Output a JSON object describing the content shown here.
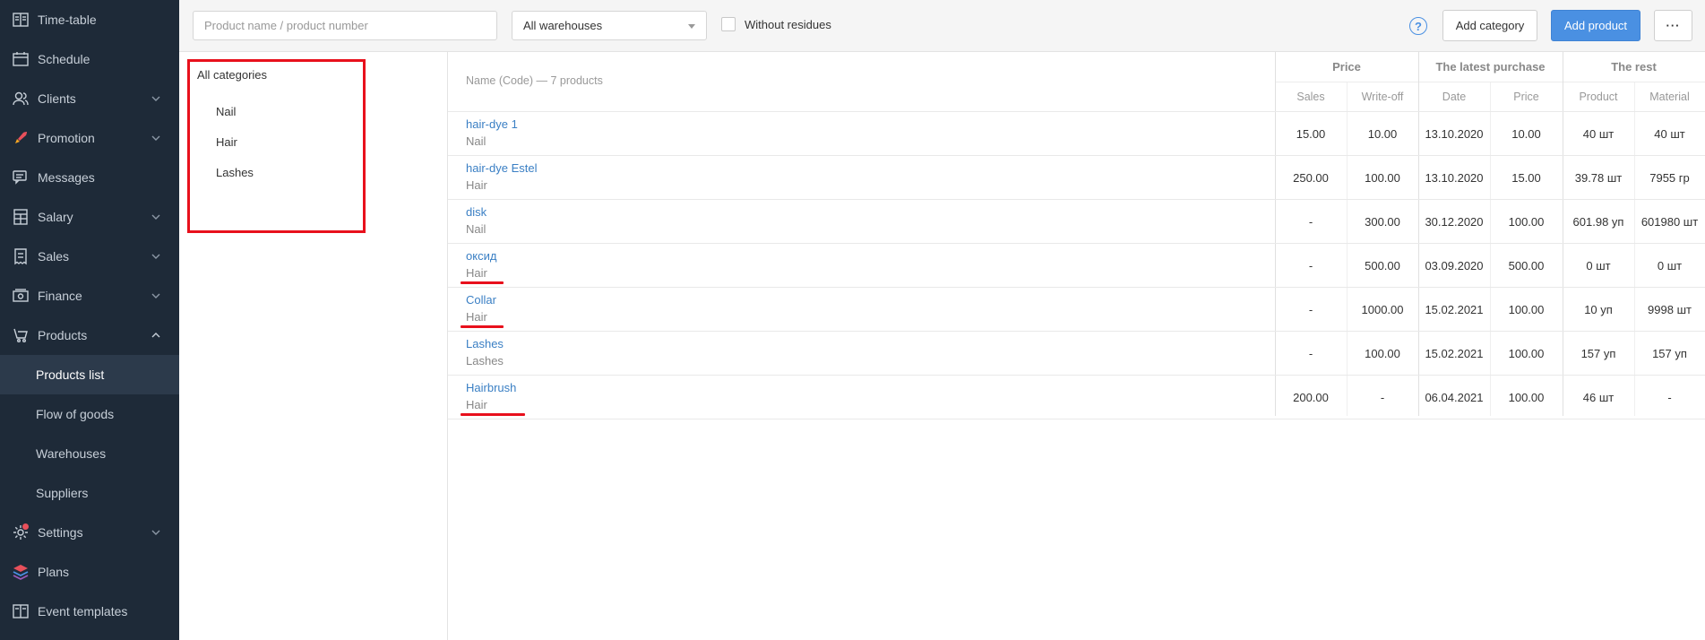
{
  "sidebar": {
    "items": [
      {
        "label": "Time-table",
        "icon": "book-icon",
        "chevron": false
      },
      {
        "label": "Schedule",
        "icon": "calendar-icon",
        "chevron": false
      },
      {
        "label": "Clients",
        "icon": "users-icon",
        "chevron": true
      },
      {
        "label": "Promotion",
        "icon": "rocket-icon",
        "chevron": true
      },
      {
        "label": "Messages",
        "icon": "chat-icon",
        "chevron": false
      },
      {
        "label": "Salary",
        "icon": "calculator-icon",
        "chevron": true
      },
      {
        "label": "Sales",
        "icon": "receipt-icon",
        "chevron": true
      },
      {
        "label": "Finance",
        "icon": "money-icon",
        "chevron": true
      },
      {
        "label": "Products",
        "icon": "cart-icon",
        "chevron": true,
        "expanded": true
      }
    ],
    "subitems": [
      {
        "label": "Products list",
        "active": true
      },
      {
        "label": "Flow of goods"
      },
      {
        "label": "Warehouses"
      },
      {
        "label": "Suppliers"
      }
    ],
    "bottom": [
      {
        "label": "Settings",
        "icon": "gear-icon",
        "chevron": true,
        "notification": true
      },
      {
        "label": "Plans",
        "icon": "layers-icon",
        "chevron": false
      },
      {
        "label": "Event templates",
        "icon": "book-icon",
        "chevron": false
      }
    ]
  },
  "toolbar": {
    "search_placeholder": "Product name / product number",
    "warehouse_value": "All warehouses",
    "without_residues_label": "Without residues",
    "help_label": "?",
    "add_category_label": "Add category",
    "add_product_label": "Add product",
    "more_label": "···"
  },
  "categories": {
    "all_label": "All categories",
    "items": [
      "Nail",
      "Hair",
      "Lashes"
    ]
  },
  "table": {
    "name_header": "Name (Code) — 7 products",
    "groups": {
      "price": "Price",
      "purchase": "The latest purchase",
      "rest": "The rest"
    },
    "sub": {
      "sales": "Sales",
      "writeoff": "Write-off",
      "date": "Date",
      "price": "Price",
      "product": "Product",
      "material": "Material"
    },
    "rows": [
      {
        "name": "hair-dye 1",
        "category": "Nail",
        "sales": "15.00",
        "writeoff": "10.00",
        "date": "13.10.2020",
        "price": "10.00",
        "product": "40 шт",
        "material": "40 шт",
        "underlined": false
      },
      {
        "name": "hair-dye Estel",
        "category": "Hair",
        "sales": "250.00",
        "writeoff": "100.00",
        "date": "13.10.2020",
        "price": "15.00",
        "product": "39.78 шт",
        "material": "7955 гр",
        "underlined": false
      },
      {
        "name": "disk",
        "category": "Nail",
        "sales": "-",
        "writeoff": "300.00",
        "date": "30.12.2020",
        "price": "100.00",
        "product": "601.98 уп",
        "material": "601980 шт",
        "underlined": false
      },
      {
        "name": "оксид",
        "category": "Hair",
        "sales": "-",
        "writeoff": "500.00",
        "date": "03.09.2020",
        "price": "500.00",
        "product": "0 шт",
        "material": "0 шт",
        "underlined": true
      },
      {
        "name": "Collar",
        "category": "Hair",
        "sales": "-",
        "writeoff": "1000.00",
        "date": "15.02.2021",
        "price": "100.00",
        "product": "10 уп",
        "material": "9998 шт",
        "underlined": true
      },
      {
        "name": "Lashes",
        "category": "Lashes",
        "sales": "-",
        "writeoff": "100.00",
        "date": "15.02.2021",
        "price": "100.00",
        "product": "157 уп",
        "material": "157 уп",
        "underlined": false
      },
      {
        "name": "Hairbrush",
        "category": "Hair",
        "sales": "200.00",
        "writeoff": "-",
        "date": "06.04.2021",
        "price": "100.00",
        "product": "46 шт",
        "material": "-",
        "underlined": true
      }
    ]
  },
  "colors": {
    "sidebar_bg": "#1e2a38",
    "accent": "#4a90e2",
    "link": "#3a7fc4",
    "highlight": "#e8101c"
  }
}
